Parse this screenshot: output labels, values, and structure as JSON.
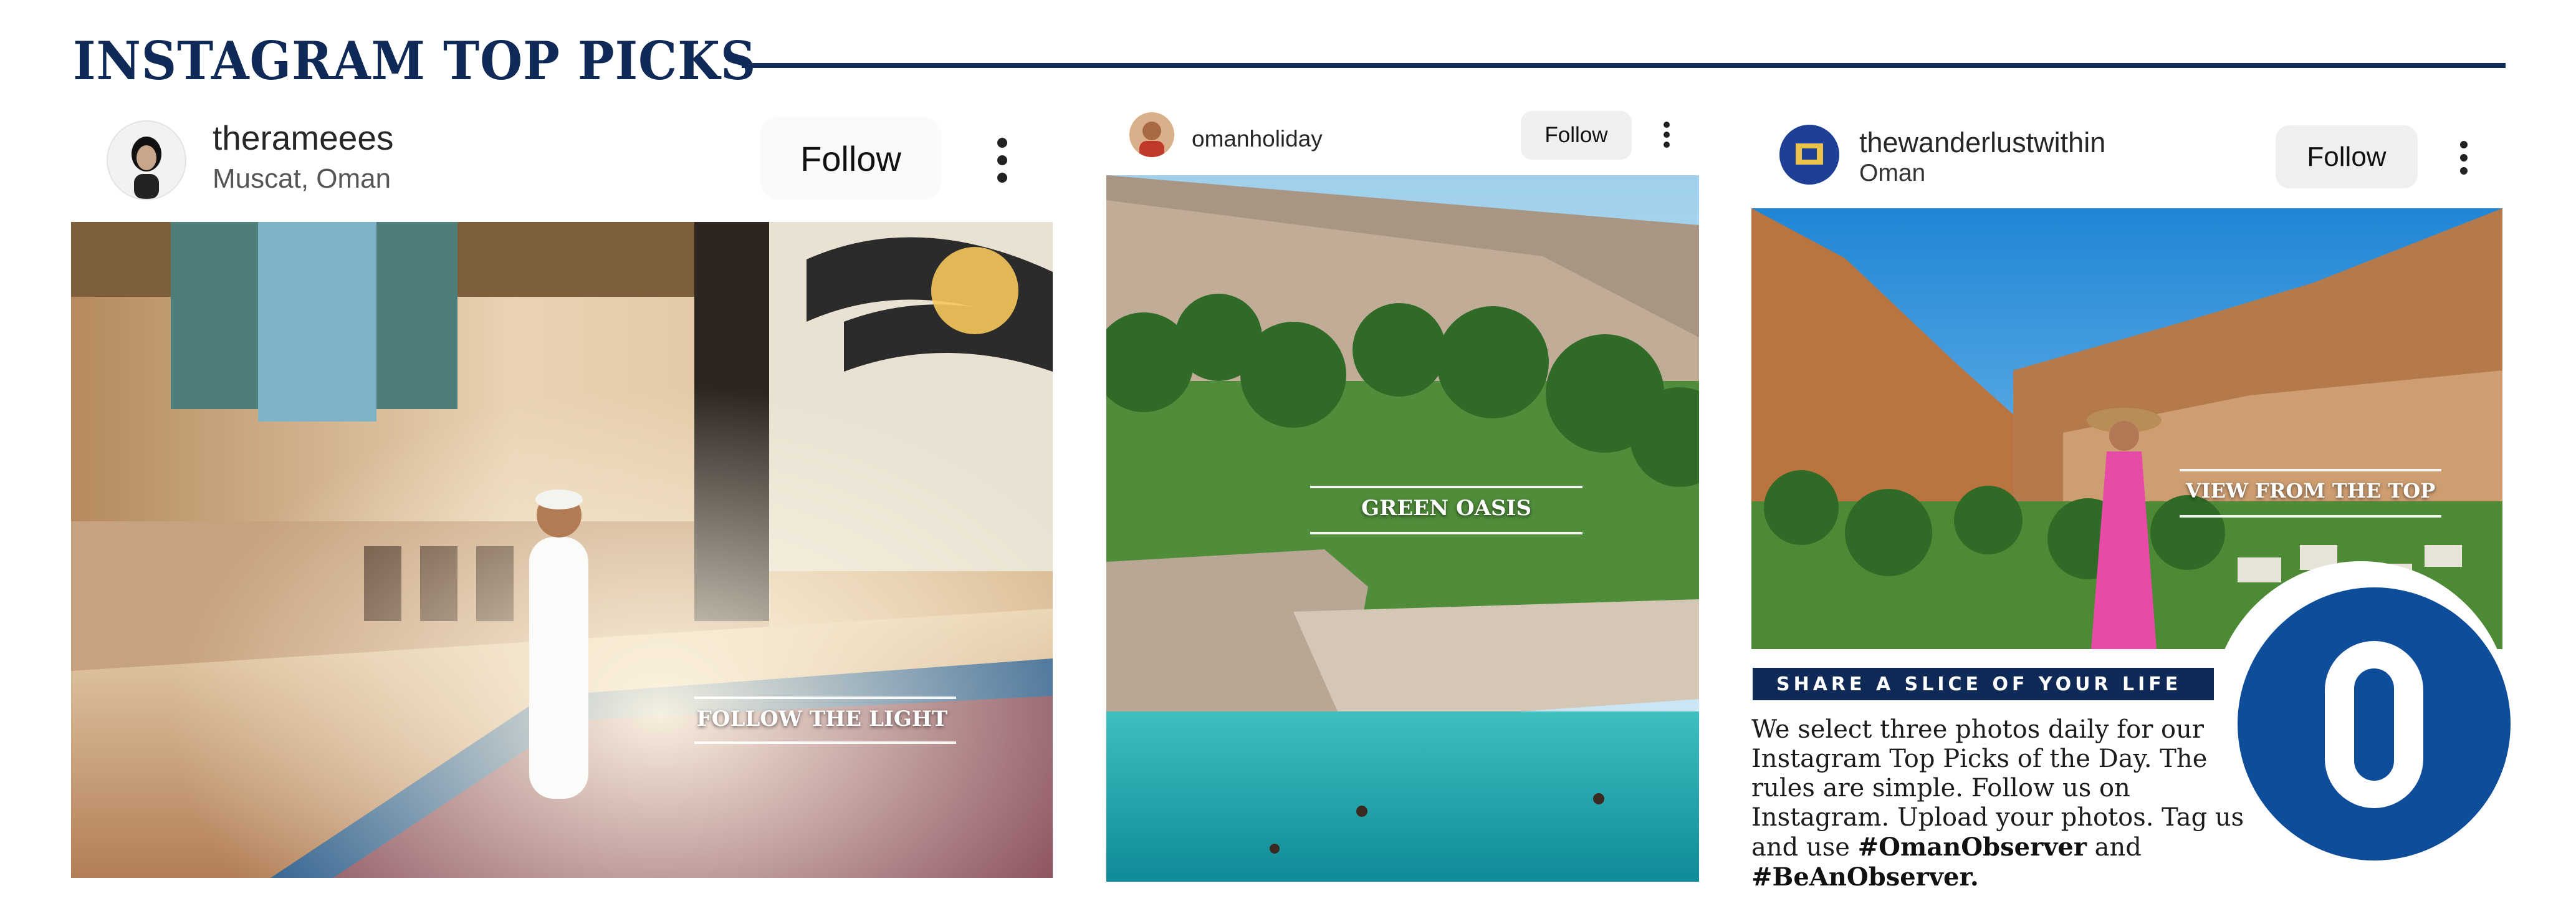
{
  "page": {
    "title": "INSTAGRAM TOP PICKS"
  },
  "posts": [
    {
      "username": "therameees",
      "location": "Muscat, Oman",
      "follow_label": "Follow",
      "caption": "FOLLOW THE LIGHT",
      "avatar": "man-portrait-avatar",
      "more_icon": "more-vertical-icon"
    },
    {
      "username": "omanholiday",
      "follow_label": "Follow",
      "caption": "GREEN OASIS",
      "avatar": "person-avatar",
      "more_icon": "more-vertical-icon"
    },
    {
      "username": "thewanderlustwithin",
      "location": "Oman",
      "follow_label": "Follow",
      "caption": "VIEW FROM THE TOP",
      "avatar": "travel-badge-avatar",
      "more_icon": "more-vertical-icon"
    }
  ],
  "info": {
    "banner": "SHARE A SLICE OF YOUR LIFE",
    "body": "We select three photos daily for our Instagram Top Picks of the Day. The rules are simple. Follow us on Instagram. Upload your photos. Tag us and use",
    "hashtag1": "#OmanObserver",
    "joiner": "and",
    "hashtag2": "#BeAnObserver.",
    "logo_letter": "O"
  },
  "colors": {
    "brand_navy": "#0f2a56",
    "logo_blue": "#0d4d9a",
    "follow_bg": "#efefef"
  }
}
